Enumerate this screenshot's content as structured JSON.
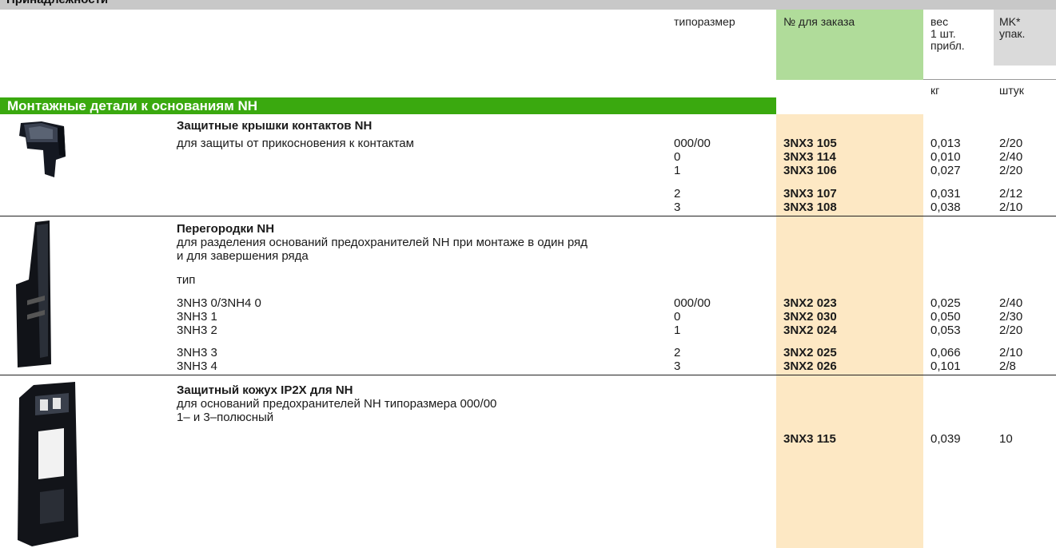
{
  "page_title": "Принадлежности",
  "header": {
    "size": "типоразмер",
    "order": "№ для заказа",
    "weight": "вес\n1 шт.\nприбл.",
    "pack": "MK*\nупак.",
    "weight_unit": "кг",
    "pack_unit": "штук"
  },
  "section": {
    "title": "Монтажные детали к основаниям NH"
  },
  "blocks": [
    {
      "title": "Защитные крышки контактов NH",
      "description": "для защиты от прикосновения к контактам",
      "rows": [
        {
          "type": "",
          "size": "000/00",
          "order": "3NX3 105",
          "weight": "0,013",
          "pack": "2/20"
        },
        {
          "type": "",
          "size": "0",
          "order": "3NX3 114",
          "weight": "0,010",
          "pack": "2/40"
        },
        {
          "type": "",
          "size": "1",
          "order": "3NX3 106",
          "weight": "0,027",
          "pack": "2/20"
        },
        {
          "type": "",
          "size": "2",
          "order": "3NX3 107",
          "weight": "0,031",
          "pack": "2/12"
        },
        {
          "type": "",
          "size": "3",
          "order": "3NX3 108",
          "weight": "0,038",
          "pack": "2/10"
        }
      ]
    },
    {
      "title": "Перегородки NH",
      "description_1": "для разделения оснований предохранителей NH при монтаже в один ряд",
      "description_2": "и для завершения ряда",
      "type_label": "тип",
      "rows": [
        {
          "type": "3NH3 0/3NH4 0",
          "size": "000/00",
          "order": "3NX2 023",
          "weight": "0,025",
          "pack": "2/40"
        },
        {
          "type": "3NH3 1",
          "size": "0",
          "order": "3NX2 030",
          "weight": "0,050",
          "pack": "2/30"
        },
        {
          "type": "3NH3 2",
          "size": "1",
          "order": "3NX2 024",
          "weight": "0,053",
          "pack": "2/20"
        },
        {
          "type": "3NH3 3",
          "size": "2",
          "order": "3NX2 025",
          "weight": "0,066",
          "pack": "2/10"
        },
        {
          "type": "3NH3 4",
          "size": "3",
          "order": "3NX2 026",
          "weight": "0,101",
          "pack": "2/8"
        }
      ]
    },
    {
      "title": "Защитный кожух IP2X для NH",
      "description_1": "для оснований предохранителей NH типоразмера 000/00",
      "description_2": "1– и 3–полюсный",
      "rows": [
        {
          "order": "3NX3 115",
          "weight": "0,039",
          "pack": "10"
        }
      ]
    }
  ]
}
